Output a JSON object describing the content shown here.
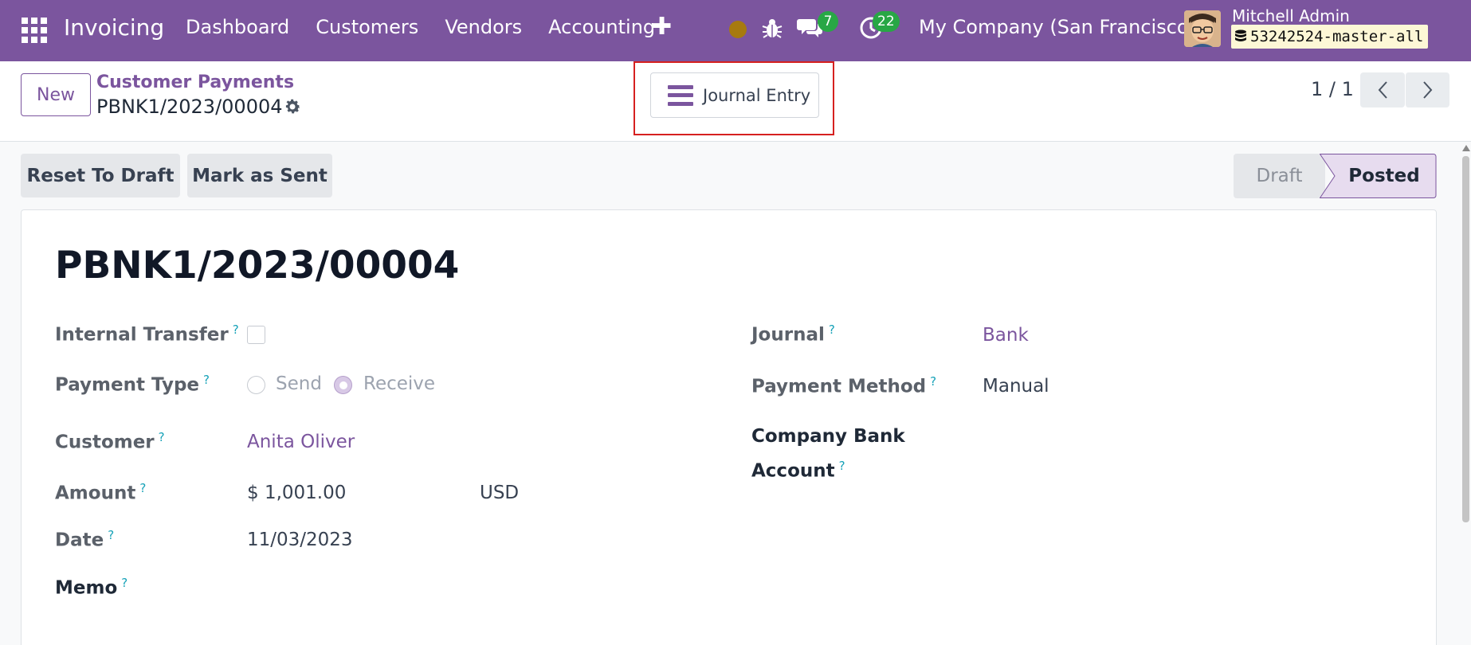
{
  "navbar": {
    "app_title": "Invoicing",
    "menu": [
      "Dashboard",
      "Customers",
      "Vendors",
      "Accounting"
    ],
    "chat_count": "7",
    "activity_count": "22",
    "company": "My Company (San Francisco)",
    "user_name": "Mitchell Admin",
    "database": "53242524-master-all",
    "bg_color": "#7b559e"
  },
  "control": {
    "new_label": "New",
    "breadcrumb": "Customer Payments",
    "record_name": "PBNK1/2023/00004",
    "smart_button": "Journal Entry",
    "pager": "1 / 1"
  },
  "actions": {
    "reset_label": "Reset To Draft",
    "sent_label": "Mark as Sent"
  },
  "status": {
    "draft": "Draft",
    "posted": "Posted",
    "active": "Posted"
  },
  "form": {
    "title": "PBNK1/2023/00004",
    "internal_transfer_label": "Internal Transfer",
    "internal_transfer_value": false,
    "payment_type_label": "Payment Type",
    "payment_type_send": "Send",
    "payment_type_receive": "Receive",
    "payment_type_selected": "Receive",
    "customer_label": "Customer",
    "customer_value": "Anita Oliver",
    "amount_label": "Amount",
    "amount_value": "$ 1,001.00",
    "currency_value": "USD",
    "date_label": "Date",
    "date_value": "11/03/2023",
    "memo_label": "Memo",
    "journal_label": "Journal",
    "journal_value": "Bank",
    "payment_method_label": "Payment Method",
    "payment_method_value": "Manual",
    "company_bank_label_line1": "Company Bank",
    "company_bank_label_line2": "Account",
    "help_mark": "?"
  }
}
